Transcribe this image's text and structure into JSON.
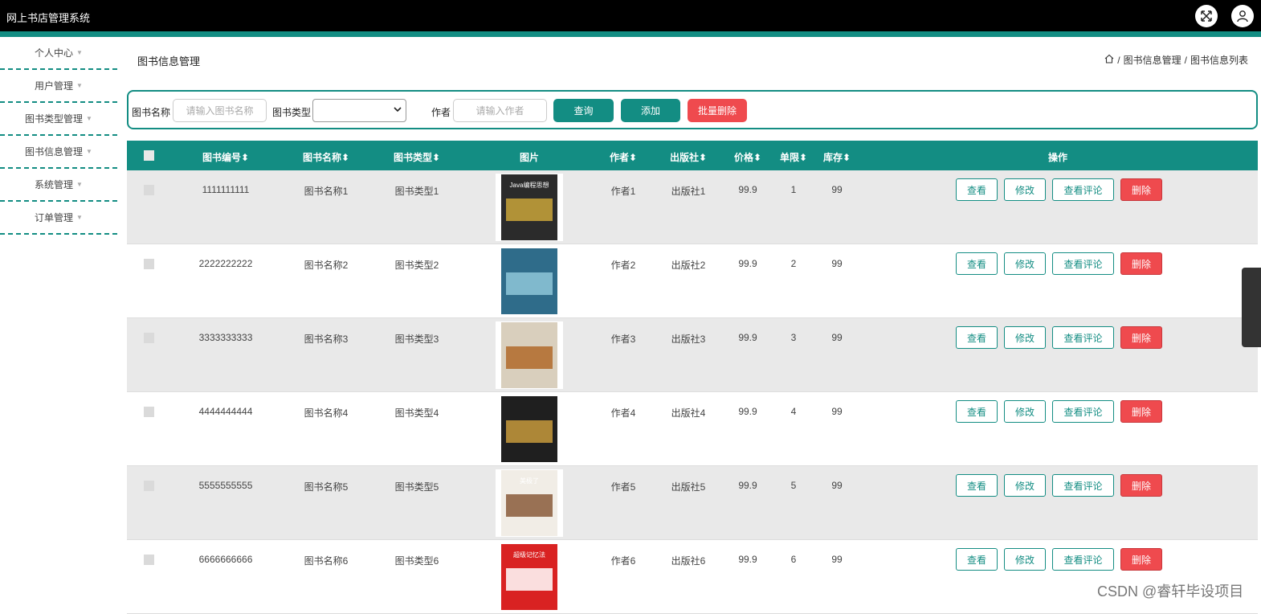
{
  "app": {
    "title": "网上书店管理系统"
  },
  "sidebar": {
    "items": [
      {
        "label": "个人中心"
      },
      {
        "label": "用户管理"
      },
      {
        "label": "图书类型管理"
      },
      {
        "label": "图书信息管理"
      },
      {
        "label": "系统管理"
      },
      {
        "label": "订单管理"
      }
    ]
  },
  "page": {
    "title": "图书信息管理",
    "breadcrumb": [
      "图书信息管理",
      "图书信息列表"
    ]
  },
  "search": {
    "name_label": "图书名称",
    "name_placeholder": "请输入图书名称",
    "type_label": "图书类型",
    "type_value": "",
    "author_label": "作者",
    "author_placeholder": "请输入作者",
    "query_button": "查询",
    "add_button": "添加",
    "batch_delete_button": "批量删除"
  },
  "table": {
    "headers": {
      "code": "图书编号",
      "name": "图书名称",
      "type": "图书类型",
      "image": "图片",
      "author": "作者",
      "publisher": "出版社",
      "price": "价格",
      "limit": "单限",
      "stock": "库存",
      "actions": "操作"
    },
    "sort_glyph": "⬍",
    "action_labels": {
      "view": "查看",
      "edit": "修改",
      "comments": "查看评论",
      "delete": "删除"
    },
    "rows": [
      {
        "code": "1111111111",
        "name": "图书名称1",
        "type": "图书类型1",
        "author": "作者1",
        "publisher": "出版社1",
        "price": "99.9",
        "limit": "1",
        "stock": "99",
        "cover_color": "#2b2b2b",
        "cover_accent": "#c9a43a",
        "cover_text": "Java编程思想"
      },
      {
        "code": "2222222222",
        "name": "图书名称2",
        "type": "图书类型2",
        "author": "作者2",
        "publisher": "出版社2",
        "price": "99.9",
        "limit": "2",
        "stock": "99",
        "cover_color": "#2f6c8a",
        "cover_accent": "#8ec7d8",
        "cover_text": ""
      },
      {
        "code": "3333333333",
        "name": "图书名称3",
        "type": "图书类型3",
        "author": "作者3",
        "publisher": "出版社3",
        "price": "99.9",
        "limit": "3",
        "stock": "99",
        "cover_color": "#d9cfbd",
        "cover_accent": "#b06a2a",
        "cover_text": ""
      },
      {
        "code": "4444444444",
        "name": "图书名称4",
        "type": "图书类型4",
        "author": "作者4",
        "publisher": "出版社4",
        "price": "99.9",
        "limit": "4",
        "stock": "99",
        "cover_color": "#1f1f1f",
        "cover_accent": "#c79a3c",
        "cover_text": ""
      },
      {
        "code": "5555555555",
        "name": "图书名称5",
        "type": "图书类型5",
        "author": "作者5",
        "publisher": "出版社5",
        "price": "99.9",
        "limit": "5",
        "stock": "99",
        "cover_color": "#f1ede6",
        "cover_accent": "#8a5a3a",
        "cover_text": "美极了"
      },
      {
        "code": "6666666666",
        "name": "图书名称6",
        "type": "图书类型6",
        "author": "作者6",
        "publisher": "出版社6",
        "price": "99.9",
        "limit": "6",
        "stock": "99",
        "cover_color": "#d92222",
        "cover_accent": "#ffffff",
        "cover_text": "超级记忆法"
      }
    ]
  },
  "watermark": "CSDN @睿轩毕设项目",
  "colors": {
    "accent": "#138d83",
    "danger": "#ef4a4e",
    "topbar": "#000000"
  }
}
